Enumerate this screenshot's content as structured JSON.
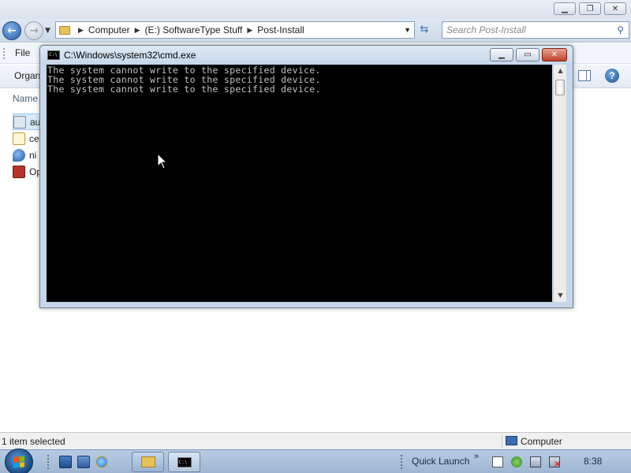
{
  "explorer": {
    "address": {
      "crumbs": [
        "Computer",
        "(E:) SoftwareType Stuff",
        "Post-Install"
      ]
    },
    "search_placeholder": "Search Post-Install",
    "menu": {
      "file": "File"
    },
    "toolbar": {
      "organize": "Organ"
    },
    "column_header": "Name",
    "files": [
      {
        "name": "au",
        "icon": "setup-gear-icon",
        "selected": true
      },
      {
        "name": "ce",
        "icon": "certificate-icon",
        "selected": false
      },
      {
        "name": "ni",
        "icon": "blue-drop-icon",
        "selected": false
      },
      {
        "name": "Op",
        "icon": "red-package-icon",
        "selected": false
      }
    ],
    "status": {
      "selection": "1 item selected",
      "location": "Computer"
    }
  },
  "cmd": {
    "title": "C:\\Windows\\system32\\cmd.exe",
    "icon_text": "C:\\",
    "lines": [
      "The system cannot write to the specified device.",
      "The system cannot write to the specified device.",
      "The system cannot write to the specified device."
    ],
    "colors": {
      "background": "#000000",
      "text": "#c0c0c0"
    }
  },
  "taskbar": {
    "quick_launch_label": "Quick Launch",
    "chevron": "»",
    "clock": "8:38",
    "task_buttons": [
      "folder-icon",
      "cmd-icon"
    ]
  }
}
